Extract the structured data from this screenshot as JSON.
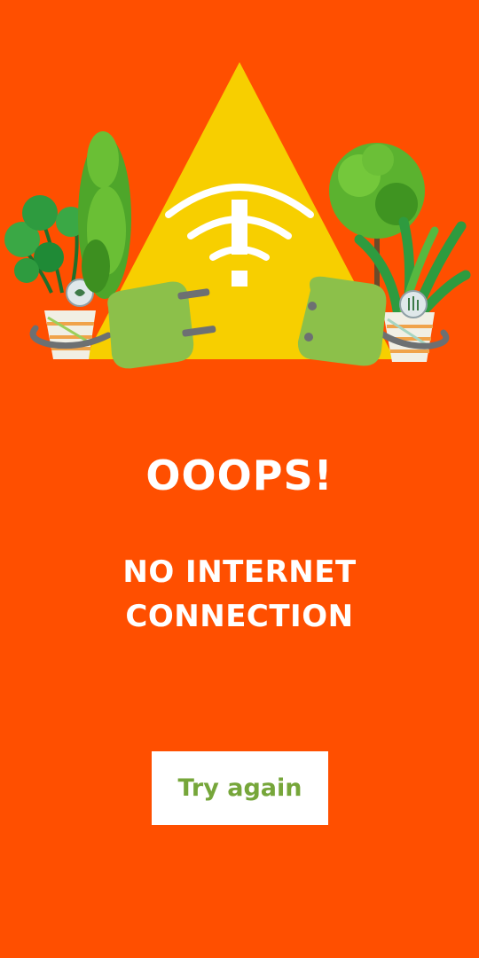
{
  "error": {
    "title": "OOOPS!",
    "message_line1": "NO INTERNET",
    "message_line2": "CONNECTION"
  },
  "actions": {
    "retry_label": "Try again"
  },
  "illustration": {
    "warning_icon": "wifi-warning-icon",
    "left_plug_icon": "electric-plug-icon",
    "right_socket_icon": "electric-socket-icon",
    "plants": [
      "potted-plant-left",
      "topiary-left",
      "topiary-right",
      "potted-plant-right"
    ]
  },
  "colors": {
    "background": "#ff4f00",
    "triangle": "#f7cf00",
    "plug": "#8cc04a",
    "button_text": "#76a63a",
    "text": "#ffffff"
  }
}
